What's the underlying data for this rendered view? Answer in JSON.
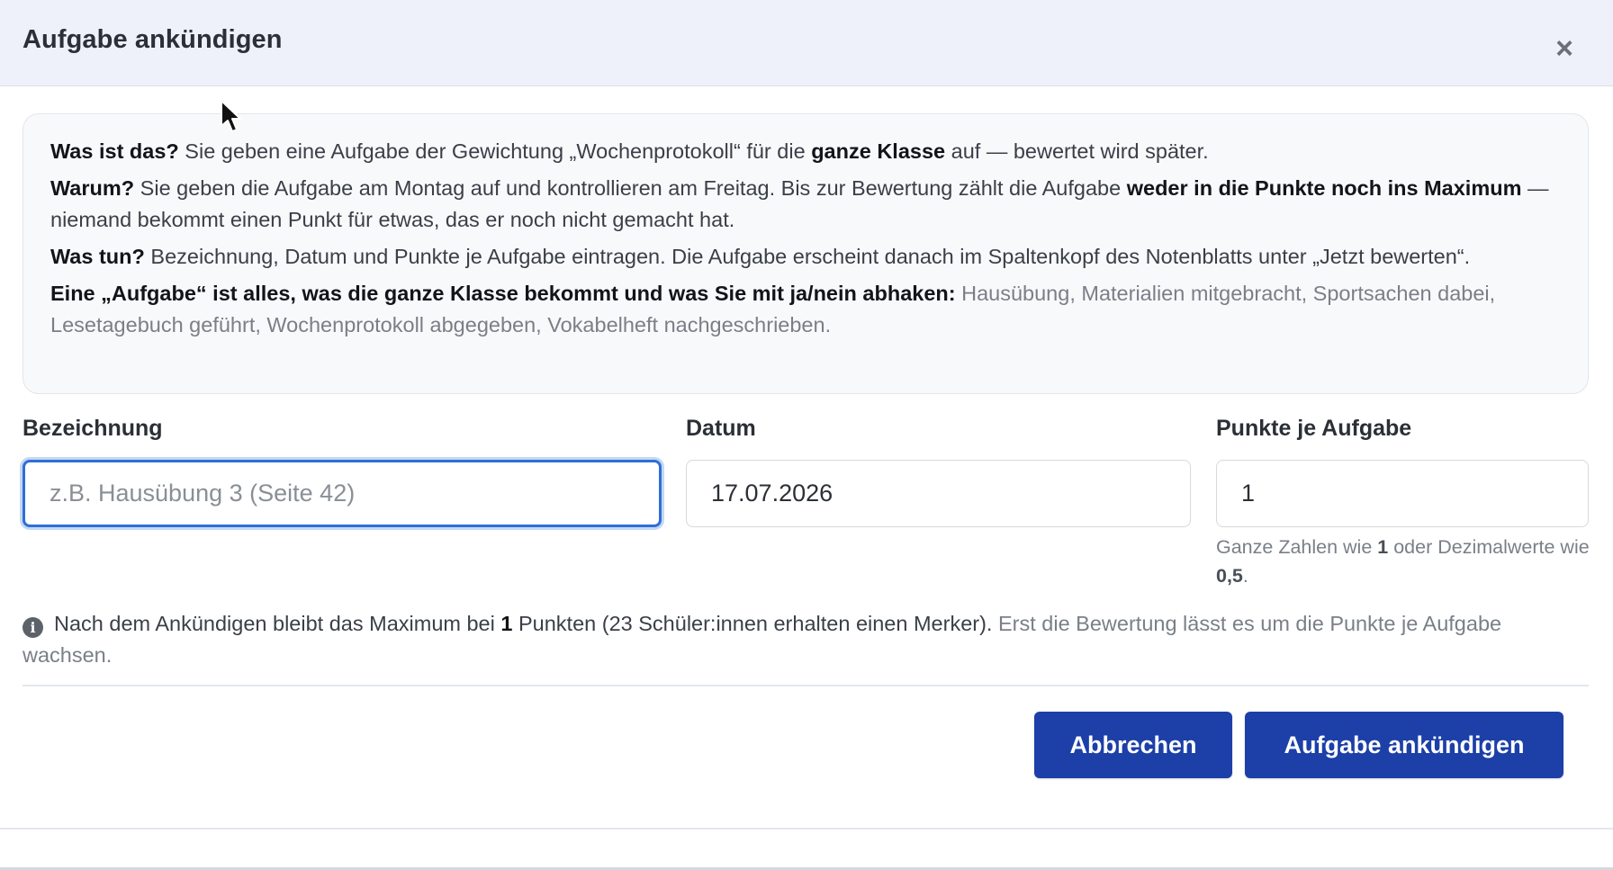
{
  "modal": {
    "title": "Aufgabe ankündigen",
    "close_glyph": "×"
  },
  "info": {
    "p1": {
      "lead": "Was ist das?",
      "t1": " Sie geben eine Aufgabe der Gewichtung „Wochenprotokoll“ für die ",
      "bold1": "ganze Klasse",
      "t2": " auf — bewertet wird später."
    },
    "p2": {
      "lead": "Warum?",
      "t1": " Sie geben die Aufgabe am Montag auf und kontrollieren am Freitag. Bis zur Bewertung zählt die Aufgabe ",
      "bold1": "weder in die Punkte noch ins Maximum",
      "t2": " — niemand bekommt einen Punkt für etwas, das er noch nicht gemacht hat."
    },
    "p3": {
      "lead": "Was tun?",
      "t1": " Bezeichnung, Datum und Punkte je Aufgabe eintragen. Die Aufgabe erscheint danach im Spaltenkopf des Notenblatts unter „Jetzt bewerten“."
    },
    "p4": {
      "lead": "Eine „Aufgabe“ ist alles, was die ganze Klasse bekommt und was Sie mit ja/nein abhaken:",
      "t1": " Hausübung, Materialien mitgebracht, Sportsachen dabei, Lesetagebuch geführt, Wochenprotokoll abgegeben, Vokabelheft nachgeschrieben."
    }
  },
  "form": {
    "bezeichnung": {
      "label": "Bezeichnung",
      "value": "",
      "placeholder": "z.B. Hausübung 3 (Seite 42)"
    },
    "datum": {
      "label": "Datum",
      "value": "17.07.2026"
    },
    "punkte": {
      "label": "Punkte je Aufgabe",
      "value": "1",
      "hint_t1": "Ganze Zahlen wie ",
      "hint_b1": "1",
      "hint_t2": " oder Dezimalwerte wie ",
      "hint_b2": "0,5",
      "hint_t3": "."
    }
  },
  "notice": {
    "icon": "info-circle-icon",
    "t1": "Nach dem Ankündigen bleibt das Maximum bei ",
    "b1": "1",
    "t2": " Punkten (23 Schüler:innen erhalten einen Merker).",
    "muted": " Erst die Bewertung lässt es um die Punkte je Aufgabe wachsen."
  },
  "buttons": {
    "cancel": "Abbrechen",
    "submit": "Aufgabe ankündigen"
  },
  "colors": {
    "primary": "#1c3fa8",
    "header_bg": "#eef1fa",
    "focus": "#2e6fd8"
  }
}
